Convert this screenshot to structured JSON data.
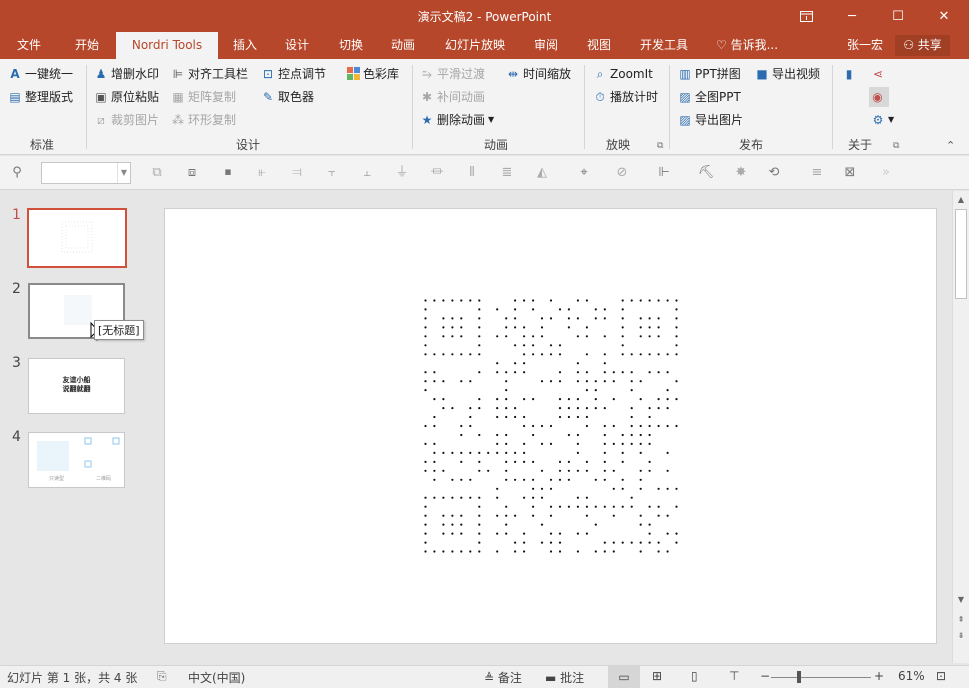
{
  "window": {
    "title": "演示文稿2 - PowerPoint",
    "restore_icon": "ribbon-display-icon",
    "minimize": "─",
    "maximize": "☐",
    "close": "✕"
  },
  "tabs": [
    {
      "label": "文件"
    },
    {
      "label": "开始"
    },
    {
      "label": "Nordri Tools"
    },
    {
      "label": "插入"
    },
    {
      "label": "设计"
    },
    {
      "label": "切换"
    },
    {
      "label": "动画"
    },
    {
      "label": "幻灯片放映"
    },
    {
      "label": "审阅"
    },
    {
      "label": "视图"
    },
    {
      "label": "开发工具"
    }
  ],
  "tell_me": "告诉我...",
  "user_name": "张一宏",
  "share_label": "共享",
  "ribbon": {
    "standard": {
      "one_click": "一键统一",
      "tidy_layout": "整理版式",
      "group": "标准"
    },
    "design": {
      "watermark": "增删水印",
      "paste_in_place": "原位粘贴",
      "crop_picture": "裁剪图片",
      "align_toolbar": "对齐工具栏",
      "matrix_copy": "矩阵复制",
      "ring_copy": "环形复制",
      "control_points": "控点调节",
      "color_picker": "取色器",
      "color_library": "色彩库",
      "group": "设计"
    },
    "animation": {
      "smooth_transition": "平滑过渡",
      "tween_animation": "补间动画",
      "delete_animation": "删除动画",
      "time_scale": "时间缩放",
      "group": "动画"
    },
    "playback": {
      "zoomit": "ZoomIt",
      "play_timer": "播放计时",
      "group": "放映"
    },
    "publish": {
      "ppt_collage": "PPT拼图",
      "export_video": "导出视频",
      "full_image": "全图PPT",
      "export_image": "导出图片",
      "group": "发布"
    },
    "about": {
      "group": "关于"
    }
  },
  "thumbnails": [
    {
      "num": "1",
      "caption": ""
    },
    {
      "num": "2",
      "caption": ""
    },
    {
      "num": "3",
      "caption": "友谊小船\n说翻就翻"
    },
    {
      "num": "4",
      "caption": ""
    }
  ],
  "thumb4_labels": {
    "left": "只读型",
    "right": "二维码"
  },
  "tooltip": "[无标题]",
  "status": {
    "slide_info": "幻灯片 第 1 张，共 4 张",
    "language": "中文(中国)",
    "notes": "备注",
    "comments": "批注",
    "zoom_minus": "−",
    "zoom_plus": "+",
    "zoom_level": "61%",
    "zoom_fraction": 0.61
  },
  "colors": {
    "accent": "#b7472a",
    "active_thumb": "#d0503a"
  }
}
